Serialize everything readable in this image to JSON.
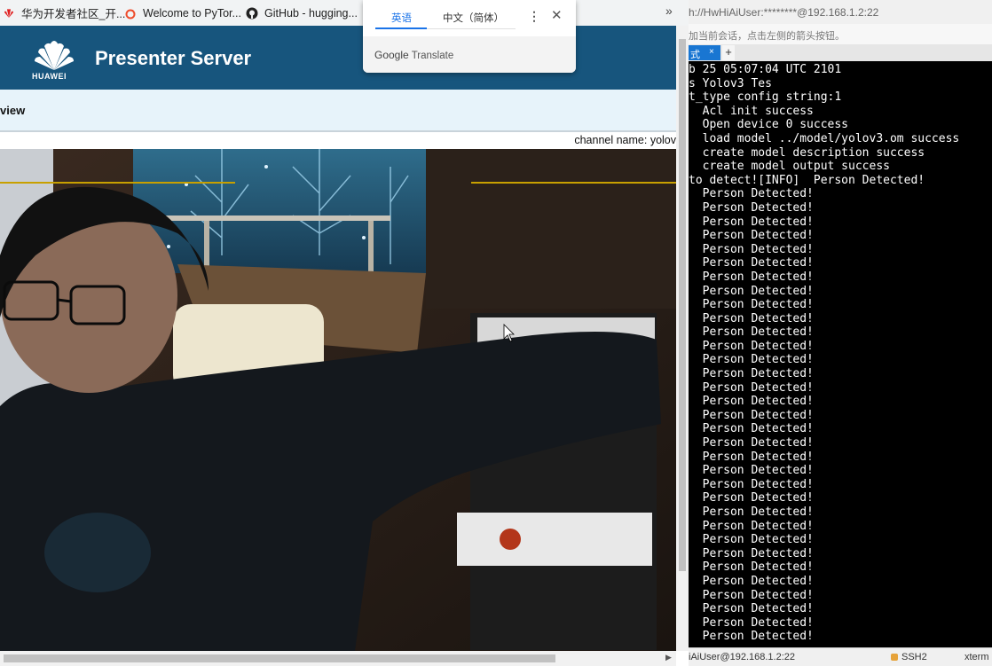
{
  "browser": {
    "bookmarks": [
      {
        "label": "华为开发者社区_开...",
        "icon": "huawei-icon"
      },
      {
        "label": "Welcome to PyTor...",
        "icon": "pytorch-icon"
      },
      {
        "label": "GitHub - hugging...",
        "icon": "github-icon"
      }
    ],
    "more_label": "»"
  },
  "app": {
    "logo_text": "HUAWEI",
    "title": "Presenter Server",
    "subnav_label": "view",
    "channel_label": "channel name: yolov"
  },
  "translate_popup": {
    "tab_source": "英语",
    "tab_target": "中文（简体）",
    "menu_label": "⋮",
    "close_label": "✕",
    "google_label": "Google",
    "translate_label": "Translate"
  },
  "terminal": {
    "title": "h://HwHiAiUser:********@192.168.1.2:22",
    "hint": "加当前会话，点击左侧的箭头按钮。",
    "tab_label": "式",
    "tab_close": "×",
    "tab_add": "+",
    "lines": [
      "b 25 05:07:04 UTC 2101",
      "s Yolov3 Tes",
      "t_type config string:1",
      "  Acl init success",
      "  Open device 0 success",
      "  load model ../model/yolov3.om success",
      "  create model description success",
      "  create model output success",
      "to detect![INFO]  Person Detected!",
      "  Person Detected!",
      "  Person Detected!",
      "  Person Detected!",
      "  Person Detected!",
      "  Person Detected!",
      "  Person Detected!",
      "  Person Detected!",
      "  Person Detected!",
      "  Person Detected!",
      "  Person Detected!",
      "  Person Detected!",
      "  Person Detected!",
      "  Person Detected!",
      "  Person Detected!",
      "  Person Detected!",
      "  Person Detected!",
      "  Person Detected!",
      "  Person Detected!",
      "  Person Detected!",
      "  Person Detected!",
      "  Person Detected!",
      "  Person Detected!",
      "  Person Detected!",
      "  Person Detected!",
      "  Person Detected!",
      "  Person Detected!",
      "  Person Detected!",
      "  Person Detected!",
      "  Person Detected!",
      "  Person Detected!",
      "  Person Detected!",
      "  Person Detected!",
      "  Person Detected!"
    ],
    "status_host": "iAiUser@192.168.1.2:22",
    "status_protocol": "SSH2",
    "status_type": "xterm"
  },
  "colors": {
    "header": "#17557d",
    "subnav": "#e7f3fa",
    "accent_blue": "#1a73e8",
    "terminal_bg": "#000000",
    "terminal_fg": "#ffffff",
    "detection_box": "#c8a000"
  }
}
